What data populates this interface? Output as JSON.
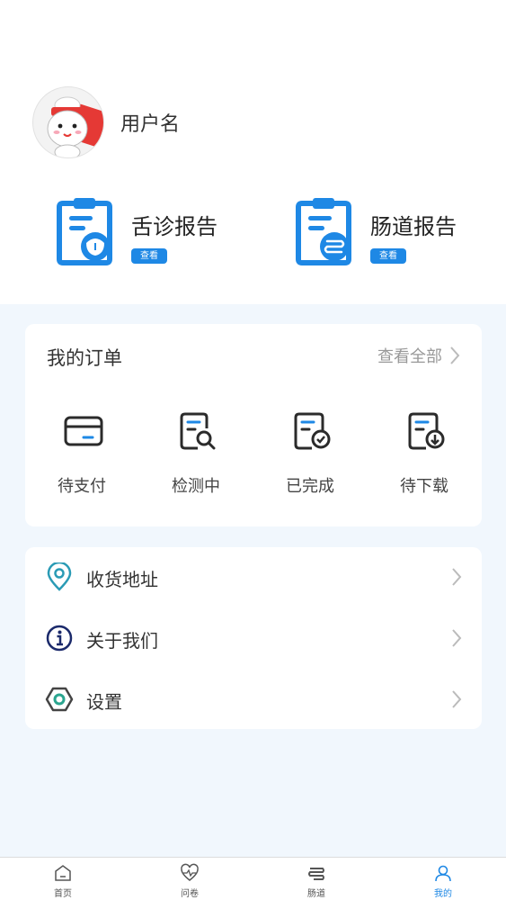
{
  "profile": {
    "username": "用户名",
    "avatar_icon": "cartoon-mascot-avatar"
  },
  "reports": [
    {
      "title": "舌诊报告",
      "badge": "查看",
      "icon": "tongue-report-icon"
    },
    {
      "title": "肠道报告",
      "badge": "查看",
      "icon": "gut-report-icon"
    }
  ],
  "orders": {
    "title": "我的订单",
    "view_all": "查看全部",
    "items": [
      {
        "label": "待支付",
        "icon": "card-icon"
      },
      {
        "label": "检测中",
        "icon": "document-search-icon"
      },
      {
        "label": "已完成",
        "icon": "document-check-icon"
      },
      {
        "label": "待下载",
        "icon": "document-download-icon"
      }
    ]
  },
  "menu": [
    {
      "label": "收货地址",
      "icon": "location-pin-icon"
    },
    {
      "label": "关于我们",
      "icon": "info-icon"
    },
    {
      "label": "设置",
      "icon": "settings-hexagon-icon"
    }
  ],
  "tabbar": [
    {
      "label": "首页",
      "icon": "home-icon"
    },
    {
      "label": "问卷",
      "icon": "heart-pulse-icon"
    },
    {
      "label": "肠道",
      "icon": "intestine-icon"
    },
    {
      "label": "我的",
      "icon": "profile-icon",
      "active": true
    }
  ],
  "colors": {
    "accent": "#1e88e5",
    "icon_dark": "#2b2b2b",
    "background": "#f1f7fd",
    "menu_icon_teal": "#2a9bb5",
    "menu_icon_navy": "#1b2a6b"
  }
}
